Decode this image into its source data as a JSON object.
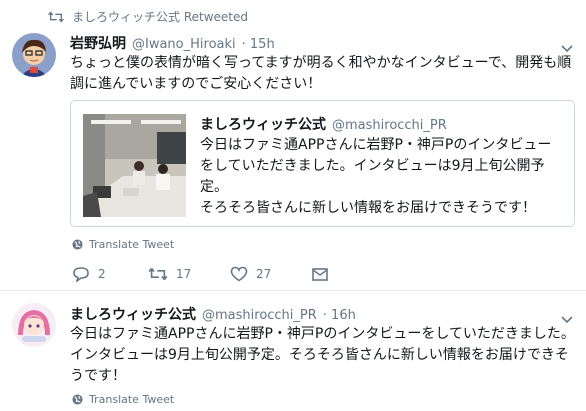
{
  "retweet_header": {
    "icon": "retweet-icon",
    "text": "ましろウィッチ公式 Retweeted"
  },
  "tweet1": {
    "name": "岩野弘明",
    "handle": "@Iwano_Hiroaki",
    "time": "· 15h",
    "text_line1": "ちょっと僕の表情が暗く写ってますが明るく和やかなインタビューで、開発も順",
    "text_line2": "調に進んでいますのでご安心ください！",
    "quoted": {
      "name": "ましろウィッチ公式",
      "handle": "@mashirocchi_PR",
      "line1": "今日はファミ通APPさんに岩野P・神戸Pのインタビュー",
      "line2": "をしていただきました。インタビューは9月上旬公開予定。",
      "line3": "そろそろ皆さんに新しい情報をお届けできそうです！"
    },
    "translate": "Translate Tweet",
    "actions": {
      "replies": "2",
      "retweets": "17",
      "likes": "27"
    }
  },
  "tweet2": {
    "name": "ましろウィッチ公式",
    "handle": "@mashirocchi_PR",
    "time": "· 16h",
    "text_line1": "今日はファミ通APPさんに岩野P・神戸Pのインタビューをしていただきました。",
    "text_line2": "インタビューは9月上旬公開予定。そろそろ皆さんに新しい情報をお届けできそ",
    "text_line3": "うです！",
    "translate": "Translate Tweet"
  },
  "colors": {
    "text": "#14171a",
    "muted": "#657786",
    "border": "#ccd6dd"
  }
}
